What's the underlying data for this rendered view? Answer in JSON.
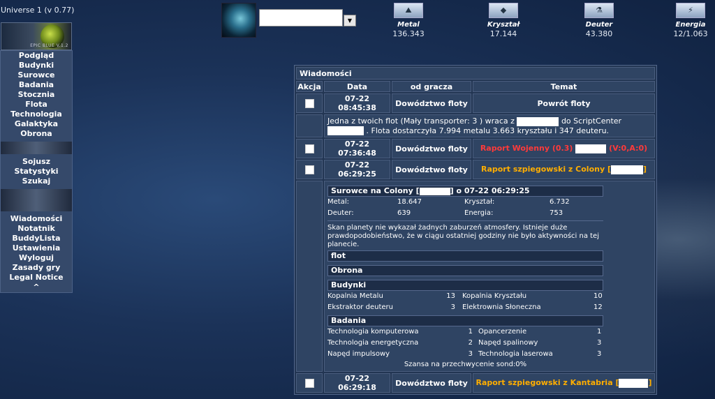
{
  "app": {
    "universe": "Universe 1 (v 0.77)",
    "logo_version": "EPIC BLUE V.1.2"
  },
  "menu": {
    "group1": [
      "Podgląd",
      "Budynki",
      "Surowce",
      "Badania",
      "Stocznia",
      "Flota",
      "Technologia",
      "Galaktyka",
      "Obrona"
    ],
    "group2": [
      "Sojusz",
      "Statystyki",
      "Szukaj"
    ],
    "group3": [
      "Wiadomości",
      "Notatnik",
      "BuddyLista",
      "Ustawienia",
      "Wyloguj",
      "Zasady gry",
      "Legal Notice",
      "^"
    ]
  },
  "resources": [
    {
      "label": "Metal",
      "value": "136.343",
      "icon": "metal-icon"
    },
    {
      "label": "Kryształ",
      "value": "17.144",
      "icon": "crystal-icon"
    },
    {
      "label": "Deuter",
      "value": "43.380",
      "icon": "deuterium-icon"
    },
    {
      "label": "Energia",
      "value": "12/1.063",
      "icon": "energy-icon"
    }
  ],
  "messages": {
    "title": "Wiadomości",
    "headers": {
      "action": "Akcja",
      "date": "Data",
      "from": "od gracza",
      "subject": "Temat"
    },
    "m1": {
      "date": "07-22 08:45:38",
      "from": "Dowództwo floty",
      "subject": "Powrót floty",
      "body_a": "Jedna z twoich flot (Mały transporter: 3 ) wraca z",
      "body_b": "do ScriptCenter",
      "body_c": ". Flota dostarczyła 7.994 metalu 3.663 kryształu i 347 deuteru."
    },
    "m2": {
      "date": "07-22 07:36:48",
      "from": "Dowództwo floty",
      "subject": "Raport Wojenny (0.3)",
      "suffix": "(V:0,A:0)"
    },
    "m3": {
      "date": "07-22 06:29:25",
      "from": "Dowództwo floty",
      "subject": "Raport szpiegowski z Colony [",
      "close": "]"
    },
    "spy": {
      "head_a": "Surowce na Colony [",
      "head_b": "] o 07-22 06:29:25",
      "res": {
        "metal_l": "Metal:",
        "metal_v": "18.647",
        "kryształ_l": "Kryształ:",
        "kryształ_v": "6.732",
        "deuter_l": "Deuter:",
        "deuter_v": "639",
        "energia_l": "Energia:",
        "energia_v": "753"
      },
      "text": "Skan planety nie wykazał żadnych zaburzeń atmosfery. Istnieje duże prawdopodobieństwo, że w ciągu ostatniej godziny nie było aktywności na tej planecie.",
      "flot": "flot",
      "obrona": "Obrona",
      "budynki": "Budynki",
      "b": {
        "b1": "Kopalnia Metalu",
        "v1": "13",
        "b2": "Kopalnia Kryształu",
        "v2": "10",
        "b3": "Ekstraktor deuteru",
        "v3": "3",
        "b4": "Elektrownia Słoneczna",
        "v4": "12"
      },
      "badania": "Badania",
      "r": {
        "r1": "Technologia komputerowa",
        "v1": "1",
        "r2": "Opancerzenie",
        "v2": "1",
        "r3": "Technologia energetyczna",
        "v3": "2",
        "r4": "Napęd spalinowy",
        "v4": "3",
        "r5": "Napęd impulsowy",
        "v5": "3",
        "r6": "Technologia laserowa",
        "v6": "3"
      },
      "chance": "Szansa na przechwycenie sond:0%"
    },
    "m4": {
      "date": "07-22 06:29:18",
      "from": "Dowództwo floty",
      "subject": "Raport szpiegowski z Kantabria [",
      "close": "]"
    }
  }
}
